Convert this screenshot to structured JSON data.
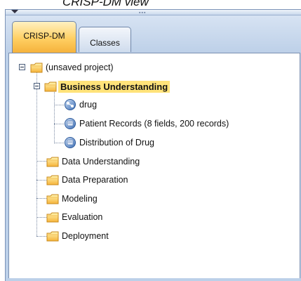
{
  "caption": "CRISP-DM view",
  "tabs": [
    {
      "label": "CRISP-DM",
      "active": true
    },
    {
      "label": "Classes",
      "active": false
    }
  ],
  "tree": {
    "root": {
      "label": "(unsaved project)",
      "expanded": true
    },
    "phases": [
      {
        "label": "Business Understanding",
        "expanded": true,
        "selected": true,
        "children": [
          {
            "label": "drug",
            "icon": "stream-icon"
          },
          {
            "label": "Patient Records (8 fields, 200 records)",
            "icon": "output-icon"
          },
          {
            "label": "Distribution of Drug",
            "icon": "output-icon"
          }
        ]
      },
      {
        "label": "Data Understanding"
      },
      {
        "label": "Data Preparation"
      },
      {
        "label": "Modeling"
      },
      {
        "label": "Evaluation"
      },
      {
        "label": "Deployment"
      }
    ]
  },
  "colors": {
    "selection": "#ffe37a",
    "active_tab": "#ffcf62",
    "frame": "#bcd0e9"
  }
}
